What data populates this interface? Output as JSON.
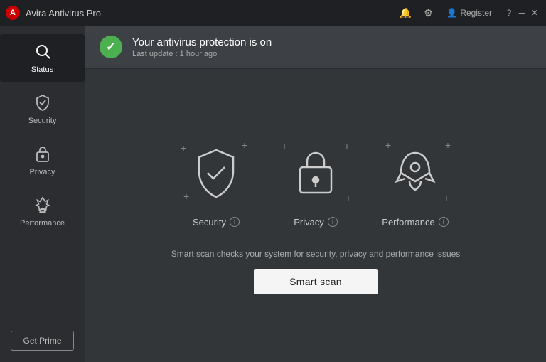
{
  "titleBar": {
    "appName": "Avira Antivirus Pro",
    "logoText": "A",
    "icons": {
      "bell": "🔔",
      "gear": "⚙",
      "user": "👤",
      "question": "?",
      "minimize": "─",
      "close": "✕"
    },
    "registerLabel": "Register"
  },
  "sidebar": {
    "items": [
      {
        "id": "status",
        "label": "Status",
        "icon": "🔍",
        "active": true
      },
      {
        "id": "security",
        "label": "Security",
        "icon": "🛡",
        "active": false
      },
      {
        "id": "privacy",
        "label": "Privacy",
        "icon": "🔒",
        "active": false
      },
      {
        "id": "performance",
        "label": "Performance",
        "icon": "🚀",
        "active": false
      }
    ],
    "getPrimeLabel": "Get Prime"
  },
  "statusBar": {
    "title": "Your antivirus protection is on",
    "subtitle": "Last update : 1 hour ago"
  },
  "features": [
    {
      "id": "security",
      "label": "Security"
    },
    {
      "id": "privacy",
      "label": "Privacy"
    },
    {
      "id": "performance",
      "label": "Performance"
    }
  ],
  "smartScan": {
    "description": "Smart scan checks your system for security, privacy and performance issues",
    "buttonLabel": "Smart scan"
  }
}
